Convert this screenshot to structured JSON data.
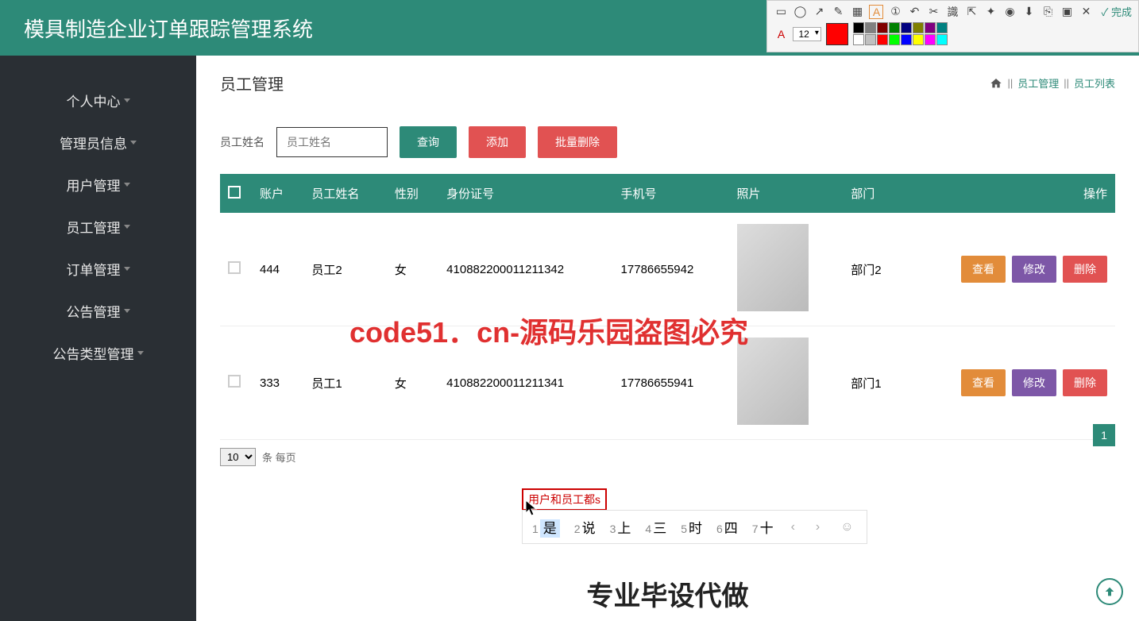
{
  "header": {
    "title": "模具制造企业订单跟踪管理系统"
  },
  "sidebar": {
    "items": [
      {
        "label": "个人中心"
      },
      {
        "label": "管理员信息"
      },
      {
        "label": "用户管理"
      },
      {
        "label": "员工管理"
      },
      {
        "label": "订单管理"
      },
      {
        "label": "公告管理"
      },
      {
        "label": "公告类型管理"
      }
    ]
  },
  "page": {
    "title": "员工管理",
    "breadcrumb": {
      "sep": "||",
      "l1": "员工管理",
      "l2": "员工列表"
    }
  },
  "filters": {
    "name_label": "员工姓名",
    "name_placeholder": "员工姓名",
    "search": "查询",
    "add": "添加",
    "batch_delete": "批量删除"
  },
  "table": {
    "headers": {
      "account": "账户",
      "name": "员工姓名",
      "gender": "性别",
      "idcard": "身份证号",
      "phone": "手机号",
      "photo": "照片",
      "dept": "部门",
      "actions": "操作"
    },
    "action_labels": {
      "view": "查看",
      "edit": "修改",
      "delete": "删除"
    },
    "rows": [
      {
        "account": "444",
        "name": "员工2",
        "gender": "女",
        "idcard": "410882200011211342",
        "phone": "17786655942",
        "dept": "部门2"
      },
      {
        "account": "333",
        "name": "员工1",
        "gender": "女",
        "idcard": "410882200011211341",
        "phone": "17786655941",
        "dept": "部门1"
      }
    ]
  },
  "pagination": {
    "page_size": "10",
    "per_page_label": "条 每页",
    "current": "1"
  },
  "ime": {
    "input": "用户和员工都s",
    "candidates": [
      {
        "n": "1",
        "w": "是"
      },
      {
        "n": "2",
        "w": "说"
      },
      {
        "n": "3",
        "w": "上"
      },
      {
        "n": "4",
        "w": "三"
      },
      {
        "n": "5",
        "w": "时"
      },
      {
        "n": "6",
        "w": "四"
      },
      {
        "n": "7",
        "w": "十"
      }
    ]
  },
  "toolbar": {
    "font_size": "12",
    "done": "完成",
    "colors_row1": [
      "#000000",
      "#808080",
      "#800000",
      "#008000",
      "#000080",
      "#808000",
      "#800080",
      "#008080"
    ],
    "colors_row2": [
      "#ffffff",
      "#c0c0c0",
      "#ff0000",
      "#00ff00",
      "#0000ff",
      "#ffff00",
      "#ff00ff",
      "#00ffff"
    ]
  },
  "watermark": {
    "text": "code51.cn",
    "red": "code51．cn-源码乐园盗图必究",
    "ad": "专业毕设代做"
  }
}
